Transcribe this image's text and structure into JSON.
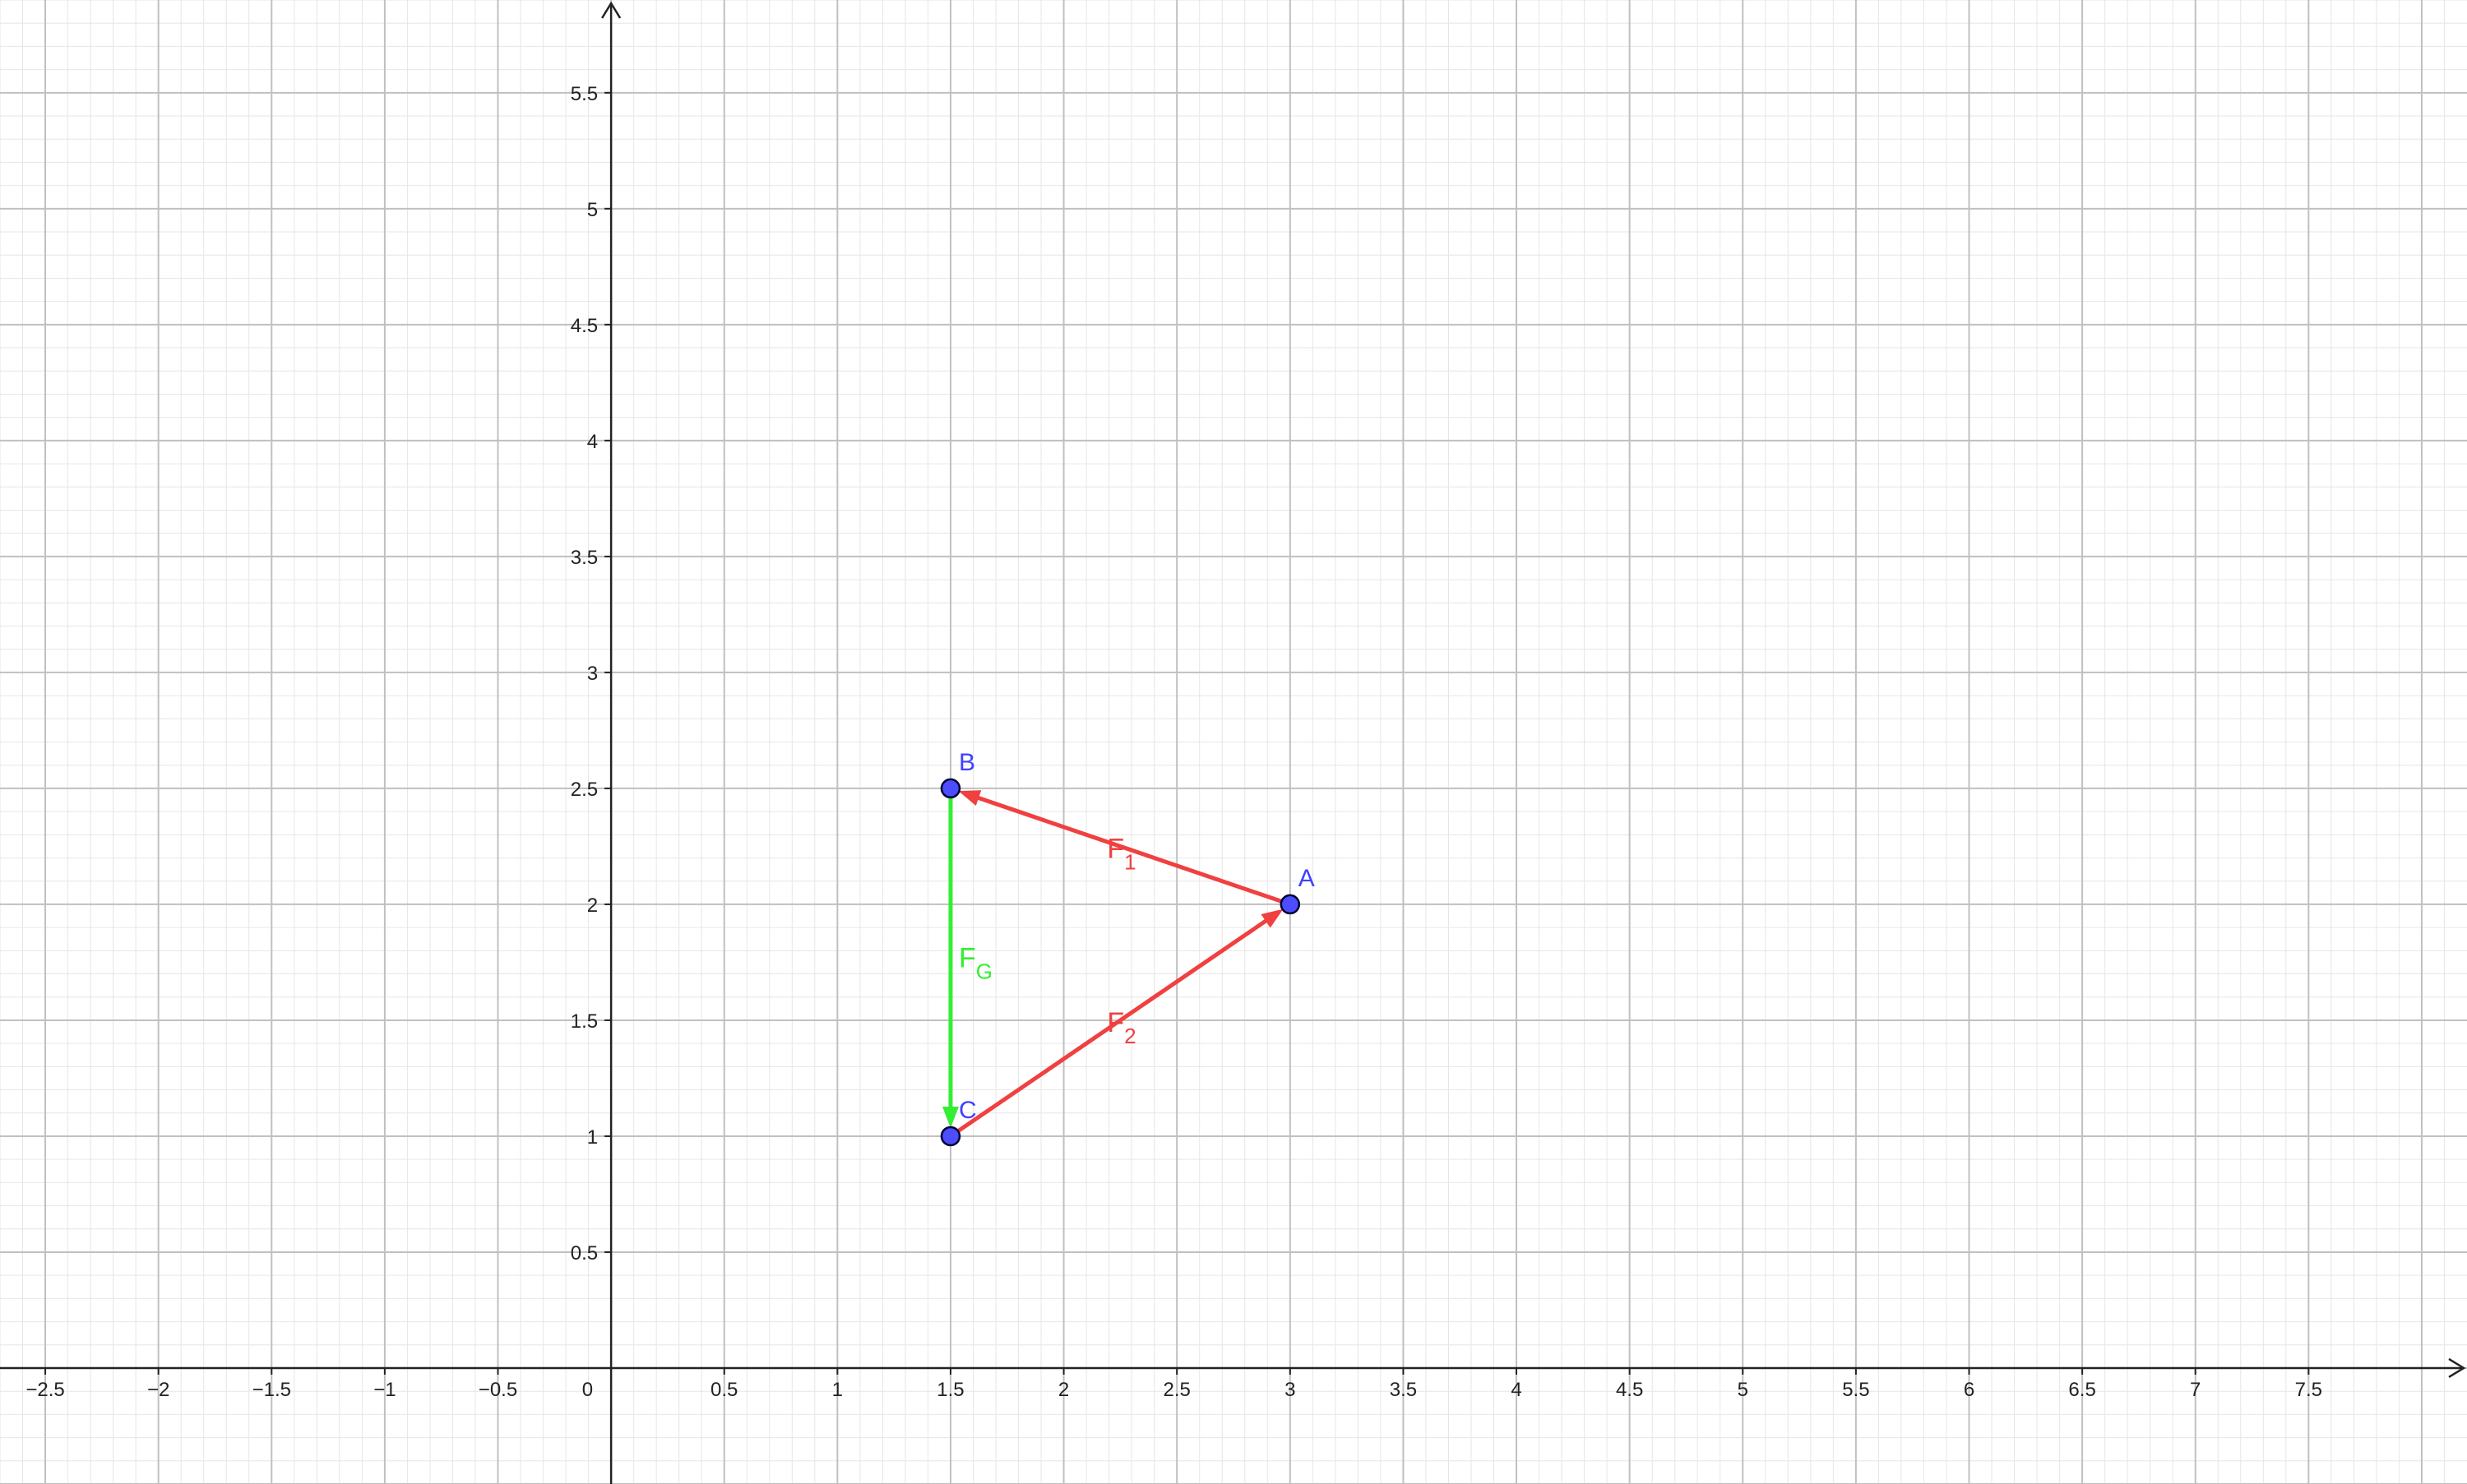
{
  "plane": {
    "x_range": [
      -2.7,
      8.2
    ],
    "y_range": [
      -0.5,
      5.9
    ],
    "x_ticks": [
      -2.5,
      -2,
      -1.5,
      -1,
      -0.5,
      0.5,
      1,
      1.5,
      2,
      2.5,
      3,
      3.5,
      4,
      4.5,
      5,
      5.5,
      6,
      6.5,
      7,
      7.5
    ],
    "y_ticks": [
      0.5,
      1,
      1.5,
      2,
      2.5,
      3,
      3.5,
      4,
      4.5,
      5,
      5.5
    ],
    "origin_label": "0",
    "major_step": 0.5,
    "minor_step": 0.1,
    "colors": {
      "background": "#ffffff",
      "grid_major": "#c0c0c0",
      "grid_minor": "#e6e6e6",
      "axis": "#222222",
      "point_fill": "#4d4dff",
      "point_stroke": "#000033",
      "point_label": "#4040ff",
      "force_red": "#f04040",
      "force_green": "#33ee33"
    }
  },
  "points": [
    {
      "label": "A",
      "x": 3,
      "y": 2
    },
    {
      "label": "B",
      "x": 1.5,
      "y": 2.5
    },
    {
      "label": "C",
      "x": 1.5,
      "y": 1
    }
  ],
  "vectors": [
    {
      "main": "F",
      "sub": "1",
      "from": "A",
      "to": "B",
      "color": "#f04040"
    },
    {
      "main": "F",
      "sub": "2",
      "from": "C",
      "to": "A",
      "color": "#f04040"
    },
    {
      "main": "F",
      "sub": "G",
      "from": "B",
      "to": "C",
      "color": "#33ee33"
    }
  ]
}
